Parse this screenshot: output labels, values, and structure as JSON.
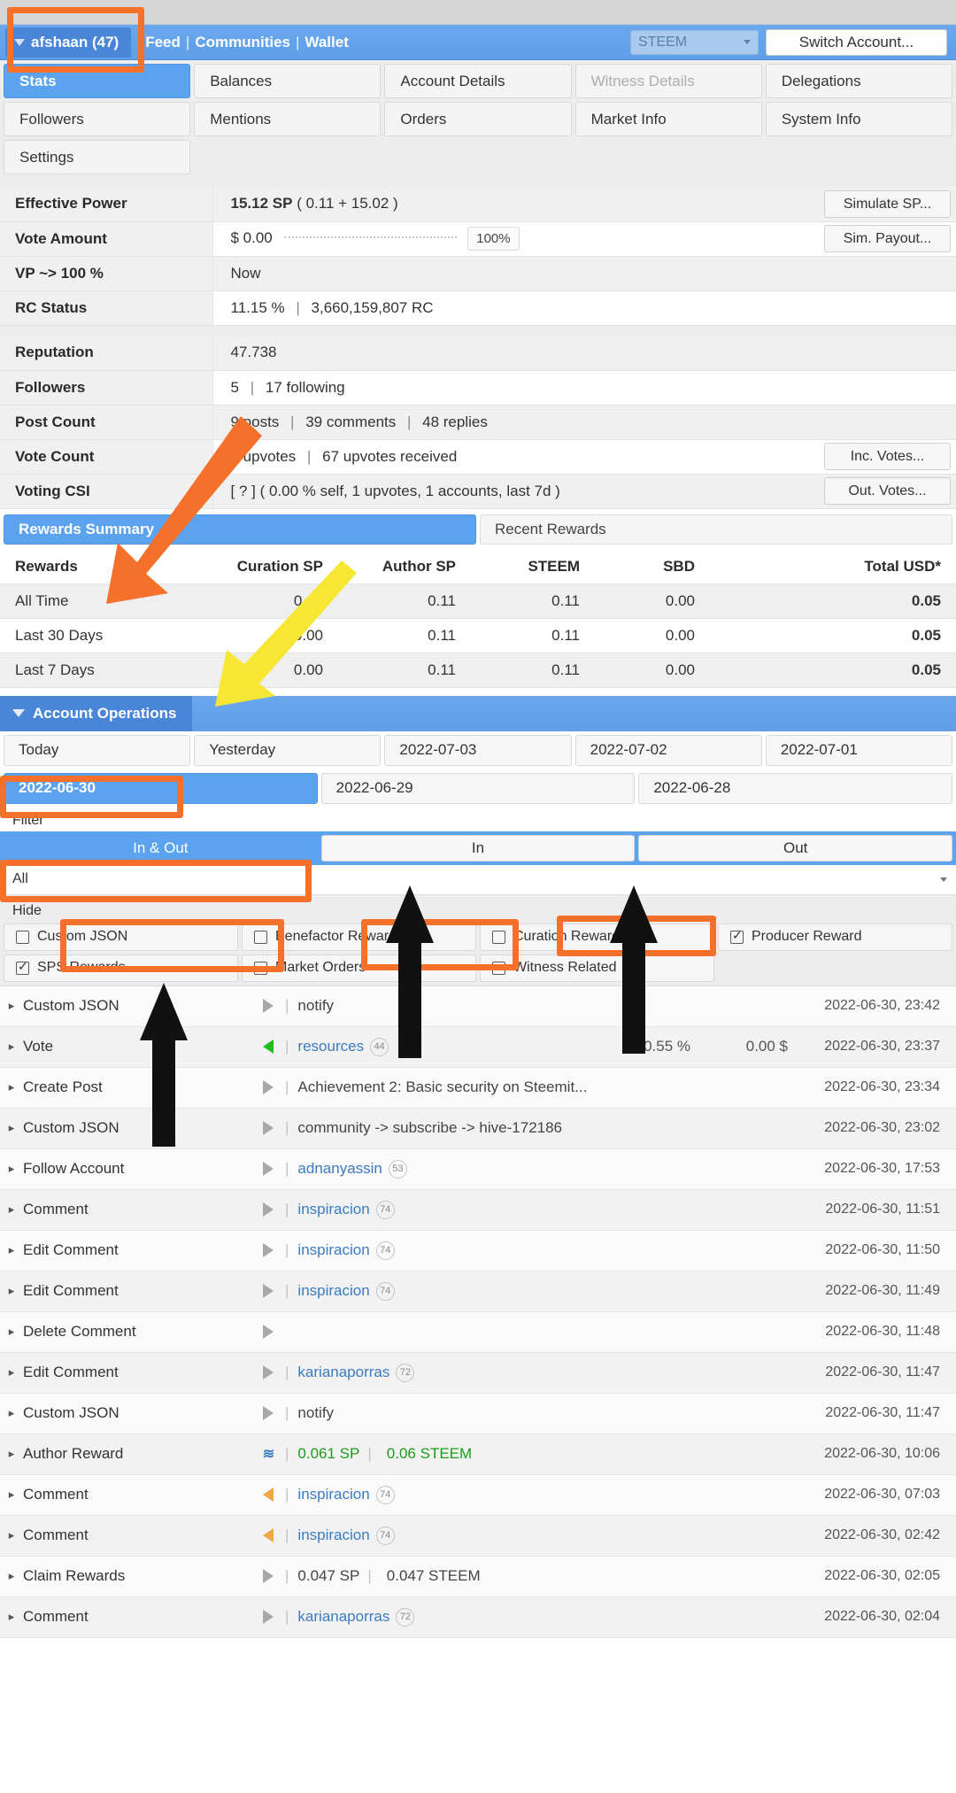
{
  "navbar": {
    "user": "afshaan (47)",
    "links": [
      "Feed",
      "Communities",
      "Wallet"
    ],
    "separator": "|",
    "token_select": "STEEM",
    "switch_account": "Switch Account..."
  },
  "tabs": [
    [
      {
        "label": "Stats",
        "state": "active"
      },
      {
        "label": "Balances",
        "state": "normal"
      },
      {
        "label": "Account Details",
        "state": "normal"
      },
      {
        "label": "Witness Details",
        "state": "disabled"
      },
      {
        "label": "Delegations",
        "state": "normal"
      }
    ],
    [
      {
        "label": "Followers",
        "state": "normal"
      },
      {
        "label": "Mentions",
        "state": "normal"
      },
      {
        "label": "Orders",
        "state": "normal"
      },
      {
        "label": "Market Info",
        "state": "normal"
      },
      {
        "label": "System Info",
        "state": "normal"
      }
    ],
    [
      {
        "label": "Settings",
        "state": "normal"
      }
    ]
  ],
  "stats": {
    "effective_power": {
      "label": "Effective Power",
      "value_bold": "15.12 SP",
      "value_rest": "( 0.11 + 15.02 )",
      "button": "Simulate SP..."
    },
    "vote_amount": {
      "label": "Vote Amount",
      "value": "$ 0.00",
      "percent": "100%",
      "button": "Sim. Payout..."
    },
    "vp_100": {
      "label": "VP ~> 100 %",
      "value": "Now"
    },
    "rc_status": {
      "label": "RC Status",
      "percent": "11.15 %",
      "sep": "|",
      "rc": "3,660,159,807 RC"
    },
    "reputation": {
      "label": "Reputation",
      "value": "47.738"
    },
    "followers": {
      "label": "Followers",
      "count": "5",
      "sep": "|",
      "following": "17 following"
    },
    "post_count": {
      "label": "Post Count",
      "posts": "9 posts",
      "comments": "39 comments",
      "replies": "48 replies"
    },
    "vote_count": {
      "label": "Vote Count",
      "given": "2 upvotes",
      "received": "67 upvotes received",
      "button": "Inc. Votes..."
    },
    "voting_csi": {
      "label": "Voting CSI",
      "value": "[ ? ] ( 0.00 % self, 1 upvotes, 1 accounts, last 7d )",
      "button": "Out. Votes..."
    }
  },
  "rewards": {
    "tabs": [
      {
        "label": "Rewards Summary",
        "state": "active"
      },
      {
        "label": "Recent Rewards",
        "state": "normal"
      }
    ],
    "columns": [
      "Rewards",
      "Curation SP",
      "Author SP",
      "STEEM",
      "SBD",
      "Total USD*"
    ],
    "rows": [
      {
        "period": "All Time",
        "curation_sp": "0.00",
        "author_sp": "0.11",
        "steem": "0.11",
        "sbd": "0.00",
        "total_usd": "0.05"
      },
      {
        "period": "Last 30 Days",
        "curation_sp": "0.00",
        "author_sp": "0.11",
        "steem": "0.11",
        "sbd": "0.00",
        "total_usd": "0.05"
      },
      {
        "period": "Last 7 Days",
        "curation_sp": "0.00",
        "author_sp": "0.11",
        "steem": "0.11",
        "sbd": "0.00",
        "total_usd": "0.05"
      }
    ]
  },
  "account_operations": {
    "title": "Account Operations",
    "date_tabs_row1": [
      {
        "label": "Today",
        "state": "normal"
      },
      {
        "label": "Yesterday",
        "state": "normal"
      },
      {
        "label": "2022-07-03",
        "state": "normal"
      },
      {
        "label": "2022-07-02",
        "state": "normal"
      },
      {
        "label": "2022-07-01",
        "state": "normal"
      }
    ],
    "date_tabs_row2": [
      {
        "label": "2022-06-30",
        "state": "active"
      },
      {
        "label": "2022-06-29",
        "state": "normal"
      },
      {
        "label": "2022-06-28",
        "state": "normal"
      }
    ],
    "filter_label": "Filter",
    "segments": [
      {
        "label": "In & Out",
        "state": "active"
      },
      {
        "label": "In",
        "state": "normal"
      },
      {
        "label": "Out",
        "state": "normal"
      }
    ],
    "all_label": "All",
    "hide_label": "Hide",
    "hide_checkboxes": [
      [
        {
          "label": "Custom JSON",
          "checked": false
        },
        {
          "label": "Benefactor Rewards",
          "checked": false
        },
        {
          "label": "Curation Rewards",
          "checked": false
        },
        {
          "label": "Producer Reward",
          "checked": true
        }
      ],
      [
        {
          "label": "SPS Rewards",
          "checked": true
        },
        {
          "label": "Market Orders",
          "checked": false
        },
        {
          "label": "Witness Related",
          "checked": false
        },
        {
          "label": "",
          "checked": false
        }
      ]
    ],
    "operations": [
      {
        "type": "Custom JSON",
        "marker": "grey",
        "detail": "notify",
        "link": false,
        "rep": "",
        "pct": "",
        "usd": "",
        "timestamp": "2022-06-30, 23:42"
      },
      {
        "type": "Vote",
        "marker": "green",
        "detail": "resources",
        "link": true,
        "rep": "44",
        "pct": "0.55 %",
        "usd": "0.00 $",
        "timestamp": "2022-06-30, 23:37"
      },
      {
        "type": "Create Post",
        "marker": "grey",
        "detail": "Achievement 2: Basic security on Steemit...",
        "link": false,
        "rep": "",
        "pct": "",
        "usd": "",
        "timestamp": "2022-06-30, 23:34"
      },
      {
        "type": "Custom JSON",
        "marker": "grey",
        "detail": "community -> subscribe -> hive-172186",
        "link": false,
        "rep": "",
        "pct": "",
        "usd": "",
        "timestamp": "2022-06-30, 23:02"
      },
      {
        "type": "Follow Account",
        "marker": "grey",
        "detail": "adnanyassin",
        "link": true,
        "rep": "53",
        "pct": "",
        "usd": "",
        "timestamp": "2022-06-30, 17:53"
      },
      {
        "type": "Comment",
        "marker": "grey",
        "detail": "inspiracion",
        "link": true,
        "rep": "74",
        "pct": "",
        "usd": "",
        "timestamp": "2022-06-30, 11:51"
      },
      {
        "type": "Edit Comment",
        "marker": "grey",
        "detail": "inspiracion",
        "link": true,
        "rep": "74",
        "pct": "",
        "usd": "",
        "timestamp": "2022-06-30, 11:50"
      },
      {
        "type": "Edit Comment",
        "marker": "grey",
        "detail": "inspiracion",
        "link": true,
        "rep": "74",
        "pct": "",
        "usd": "",
        "timestamp": "2022-06-30, 11:49"
      },
      {
        "type": "Delete Comment",
        "marker": "grey",
        "detail": "",
        "link": false,
        "rep": "",
        "pct": "",
        "usd": "",
        "timestamp": "2022-06-30, 11:48"
      },
      {
        "type": "Edit Comment",
        "marker": "grey",
        "detail": "karianaporras",
        "link": true,
        "rep": "72",
        "pct": "",
        "usd": "",
        "timestamp": "2022-06-30, 11:47"
      },
      {
        "type": "Custom JSON",
        "marker": "grey",
        "detail": "notify",
        "link": false,
        "rep": "",
        "pct": "",
        "usd": "",
        "timestamp": "2022-06-30, 11:47"
      },
      {
        "type": "Author Reward",
        "marker": "steem",
        "detail": "0.061 SP",
        "detail2": "0.06 STEEM",
        "link": false,
        "rep": "",
        "pct": "",
        "usd": "",
        "timestamp": "2022-06-30, 10:06"
      },
      {
        "type": "Comment",
        "marker": "orange",
        "detail": "inspiracion",
        "link": true,
        "rep": "74",
        "pct": "",
        "usd": "",
        "timestamp": "2022-06-30, 07:03"
      },
      {
        "type": "Comment",
        "marker": "orange",
        "detail": "inspiracion",
        "link": true,
        "rep": "74",
        "pct": "",
        "usd": "",
        "timestamp": "2022-06-30, 02:42"
      },
      {
        "type": "Claim Rewards",
        "marker": "grey",
        "detail": "0.047 SP",
        "detail2": "0.047 STEEM",
        "link": false,
        "rep": "",
        "pct": "",
        "usd": "",
        "timestamp": "2022-06-30, 02:05"
      },
      {
        "type": "Comment",
        "marker": "grey",
        "detail": "karianaporras",
        "link": true,
        "rep": "72",
        "pct": "",
        "usd": "",
        "timestamp": "2022-06-30, 02:04"
      }
    ]
  },
  "colors": {
    "accent_blue": "#5ba3ef",
    "nav_blue": "#6ba7ee",
    "annotation_orange": "#f5702a",
    "annotation_yellow": "#f5e733",
    "annotation_black": "#111111",
    "green": "#19c219"
  }
}
